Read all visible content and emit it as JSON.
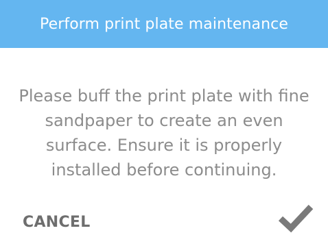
{
  "dialog": {
    "title": "Perform print plate maintenance",
    "message": "Please buff the print plate with fine sandpaper to create an even surface. Ensure it is properly installed before continuing.",
    "cancel_label": "CANCEL",
    "confirm_icon": "checkmark-icon"
  },
  "colors": {
    "title_bar": "#64b6f0",
    "title_text": "#ffffff",
    "message_text": "#8c8c8c",
    "cancel_text": "#6e6e6e",
    "checkmark": "#7a7a7a"
  }
}
